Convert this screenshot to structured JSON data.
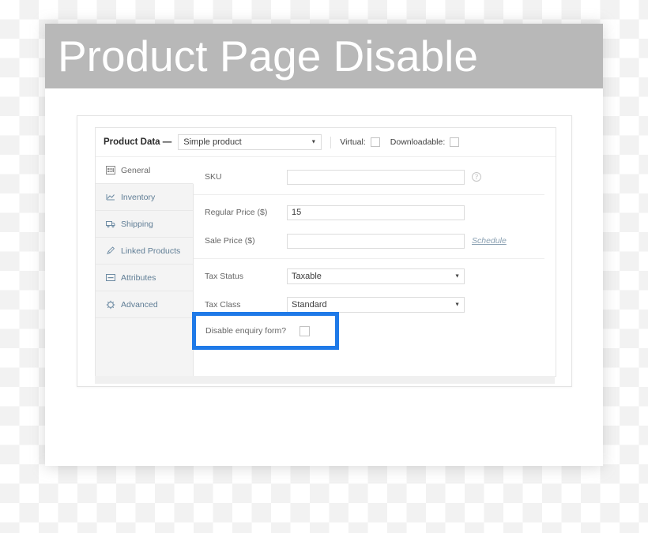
{
  "banner": {
    "title": "Product Page Disable"
  },
  "panel": {
    "header": {
      "title": "Product Data —",
      "product_type": "Simple product",
      "caret": "▼",
      "virtual_label": "Virtual:",
      "downloadable_label": "Downloadable:"
    },
    "tabs": [
      {
        "label": "General",
        "icon": "table-icon",
        "active": true
      },
      {
        "label": "Inventory",
        "icon": "chart-icon",
        "active": false
      },
      {
        "label": "Shipping",
        "icon": "truck-icon",
        "active": false
      },
      {
        "label": "Linked Products",
        "icon": "link-pencil-icon",
        "active": false
      },
      {
        "label": "Attributes",
        "icon": "list-box-icon",
        "active": false
      },
      {
        "label": "Advanced",
        "icon": "gear-icon",
        "active": false
      }
    ],
    "fields": {
      "sku_label": "SKU",
      "sku_value": "",
      "sku_help": "?",
      "regular_price_label": "Regular Price ($)",
      "regular_price_value": "15",
      "sale_price_label": "Sale Price ($)",
      "sale_price_value": "",
      "schedule_link": "Schedule",
      "tax_status_label": "Tax Status",
      "tax_status_value": "Taxable",
      "tax_class_label": "Tax Class",
      "tax_class_value": "Standard",
      "caret": "▼"
    },
    "highlight": {
      "label": "Disable enquiry form?"
    }
  },
  "colors": {
    "banner_bg": "#b8b8b8",
    "highlight_blue": "#1f7ae8",
    "tab_text": "#5f7d95",
    "link": "#8aa0b2"
  }
}
